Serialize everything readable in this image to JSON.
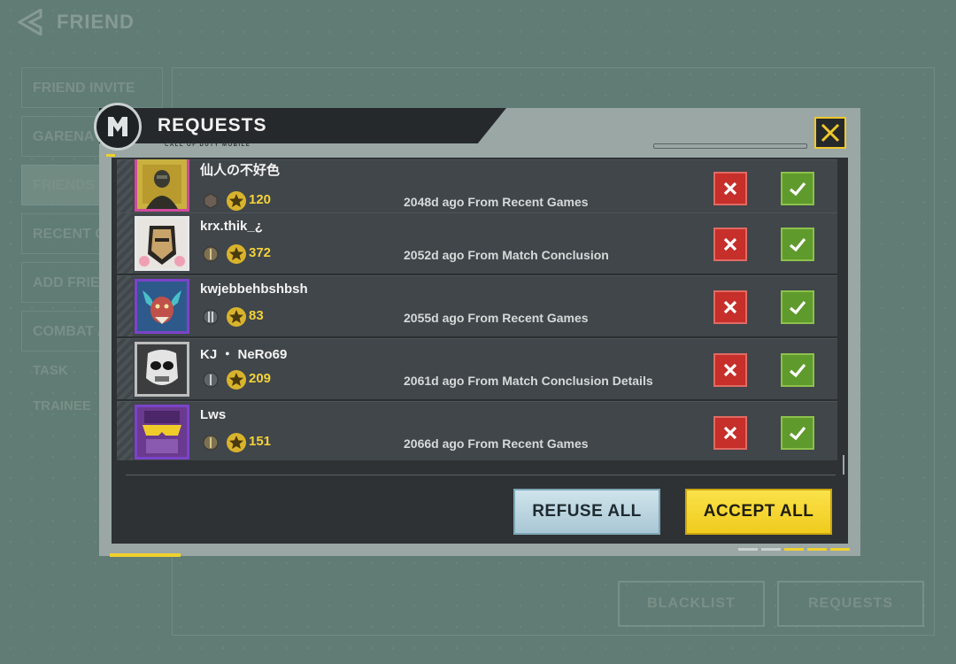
{
  "page": {
    "title": "FRIEND",
    "sidebar": [
      {
        "label": "FRIEND INVITE",
        "active": false
      },
      {
        "label": "GARENA FRIENDS",
        "active": false
      },
      {
        "label": "FRIENDS",
        "active": true
      },
      {
        "label": "RECENT GAMES",
        "active": false
      },
      {
        "label": "ADD FRIENDS",
        "active": false
      },
      {
        "label": "COMBAT ADVANCE",
        "active": false
      }
    ],
    "sidebar_extra": [
      "TASK",
      "TRAINEE"
    ],
    "bottom_buttons": {
      "blacklist": "BLACKLIST",
      "requests": "REQUESTS"
    }
  },
  "modal": {
    "title": "REQUESTS",
    "subtitle": "CALL OF DUTY MOBILE",
    "close_icon": "close-icon",
    "requests": [
      {
        "name": "仙人の不好色",
        "level": "120",
        "origin": "2048d ago From Recent Games",
        "frame": "pink",
        "avatar": "soldier-avatar"
      },
      {
        "name": "krx.thik_¿",
        "level": "372",
        "origin": "2052d ago From Match Conclusion",
        "frame": "white",
        "avatar": "masked-warrior-avatar"
      },
      {
        "name": "kwjebbehbshbsh",
        "level": "83",
        "origin": "2055d ago From Recent Games",
        "frame": "purple",
        "avatar": "monster-avatar"
      },
      {
        "name": "KJ ・ NeRo69",
        "level": "209",
        "origin": "2061d ago From Match Conclusion Details",
        "frame": "gray",
        "avatar": "ghost-skull-avatar"
      },
      {
        "name": "Lws",
        "level": "151",
        "origin": "2066d ago From Recent Games",
        "frame": "purple",
        "avatar": "goggles-avatar"
      }
    ],
    "refuse_all_label": "REFUSE ALL",
    "accept_all_label": "ACCEPT ALL"
  },
  "colors": {
    "accent_yellow": "#f0d02c",
    "refuse_red": "#c62f2a",
    "accept_green": "#5f9a2c",
    "level_gold": "#f4d23a"
  }
}
